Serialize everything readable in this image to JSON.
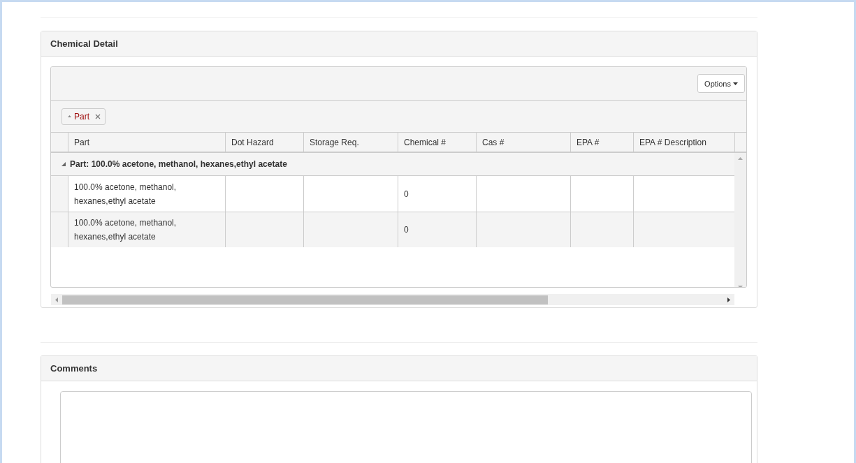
{
  "chemical_detail": {
    "title": "Chemical Detail",
    "options_button": {
      "label": "Options"
    },
    "grouping": [
      {
        "label": "Part",
        "ascending": true
      }
    ],
    "table": {
      "columns": [
        "Part",
        "Dot Hazard",
        "Storage Req.",
        "Chemical #",
        "Cas #",
        "EPA #",
        "EPA # Description"
      ],
      "groups": [
        {
          "label": "Part: 100.0% acetone, methanol, hexanes,ethyl acetate",
          "expanded": true,
          "rows": [
            [
              "100.0% acetone, methanol, hexanes,ethyl acetate",
              "",
              "",
              "0",
              "",
              "",
              ""
            ],
            [
              "100.0% acetone, methanol, hexanes,ethyl acetate",
              "",
              "",
              "0",
              "",
              "",
              ""
            ]
          ]
        }
      ]
    }
  },
  "comments": {
    "title": "Comments"
  }
}
